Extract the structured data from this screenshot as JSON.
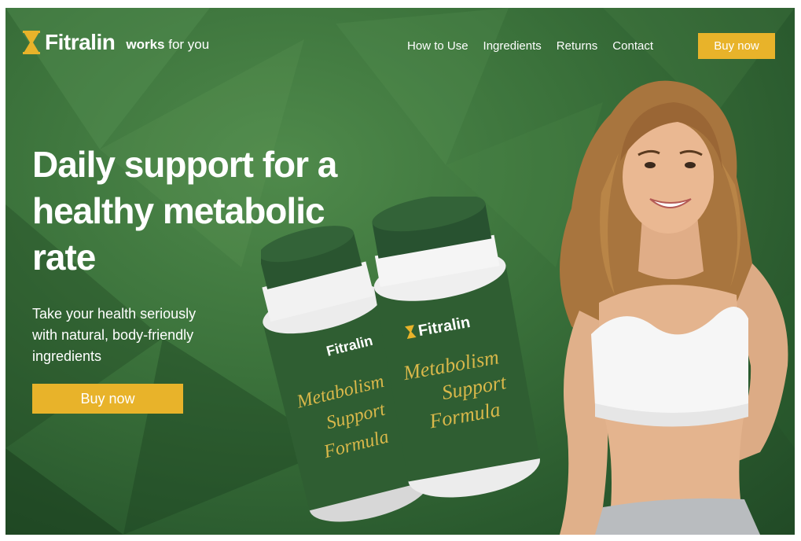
{
  "brand": {
    "name": "Fitralin",
    "tagline_bold": "works",
    "tagline_rest": "for you"
  },
  "nav": {
    "links": [
      "How to Use",
      "Ingredients",
      "Returns",
      "Contact"
    ],
    "cta": "Buy now"
  },
  "hero": {
    "headline_lines": [
      "Daily support for a",
      "healthy metabolic",
      "rate"
    ],
    "subcopy_lines": [
      "Take your health seriously",
      "with natural, body-friendly",
      "ingredients"
    ],
    "cta": "Buy now"
  },
  "product": {
    "brand": "Fitralin",
    "name_lines": [
      "Metabolism",
      "Support",
      "Formula"
    ]
  },
  "colors": {
    "accent": "#e8b32a",
    "background": "#3b723b",
    "bottle": "#2f5e32",
    "label_script": "#d9b84a"
  },
  "icons": {
    "logo": "hourglass-logo-icon"
  }
}
